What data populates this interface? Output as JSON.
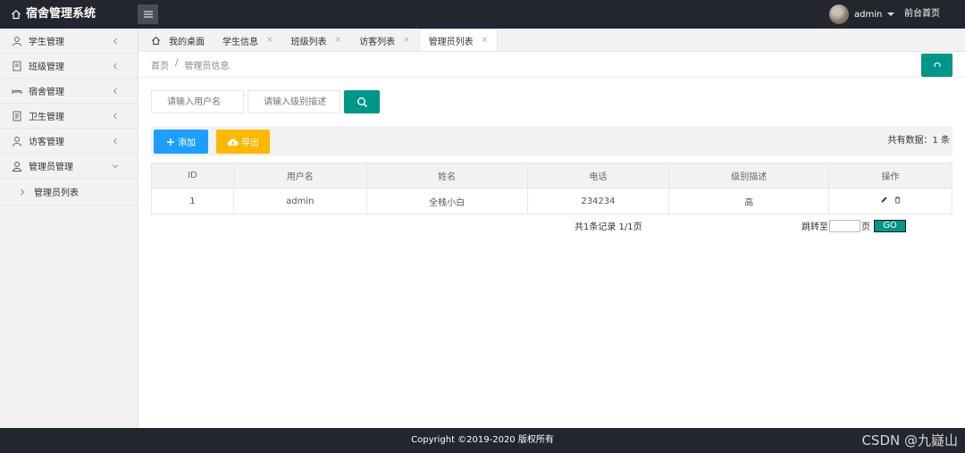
{
  "header": {
    "app_title": "宿舍管理系统",
    "username": "admin",
    "front_link": "前台首页"
  },
  "sidebar": {
    "items": [
      {
        "label": "学生管理",
        "icon": "user-icon"
      },
      {
        "label": "班级管理",
        "icon": "book-icon"
      },
      {
        "label": "宿舍管理",
        "icon": "bed-icon"
      },
      {
        "label": "卫生管理",
        "icon": "document-icon"
      },
      {
        "label": "访客管理",
        "icon": "visitor-icon"
      },
      {
        "label": "管理员管理",
        "icon": "admin-icon"
      }
    ],
    "sub_item": "管理员列表"
  },
  "tabs": [
    {
      "label": "我的桌面"
    },
    {
      "label": "学生信息",
      "close": "×"
    },
    {
      "label": "班级列表",
      "close": "×"
    },
    {
      "label": "访客列表",
      "close": "×"
    },
    {
      "label": "管理员列表",
      "close": "×"
    }
  ],
  "breadcrumb": {
    "home": "首页",
    "sep": "/",
    "current": "管理员信息"
  },
  "search": {
    "username_placeholder": "请输入用户名",
    "level_placeholder": "请输入级别描述"
  },
  "toolbar": {
    "add_label": "添加",
    "export_label": "导出",
    "total_label": "共有数据：",
    "total_value": "1 条"
  },
  "table": {
    "columns": [
      "ID",
      "用户名",
      "姓名",
      "电话",
      "级别描述",
      "操作"
    ],
    "rows": [
      {
        "id": "1",
        "username": "admin",
        "name": "全栈小白",
        "phone": "234234",
        "level": "高"
      }
    ]
  },
  "pager": {
    "info": "共1条记录  1/1页",
    "jump_label": "跳转至",
    "page_unit": "页",
    "go_label": "GO"
  },
  "footer": {
    "copyright": "Copyright ©2019-2020 版权所有"
  },
  "watermark": "CSDN @九嶷山",
  "colors": {
    "header_bg": "#23262e",
    "primary": "#009688",
    "blue": "#1e9fff",
    "orange": "#ffb800"
  }
}
